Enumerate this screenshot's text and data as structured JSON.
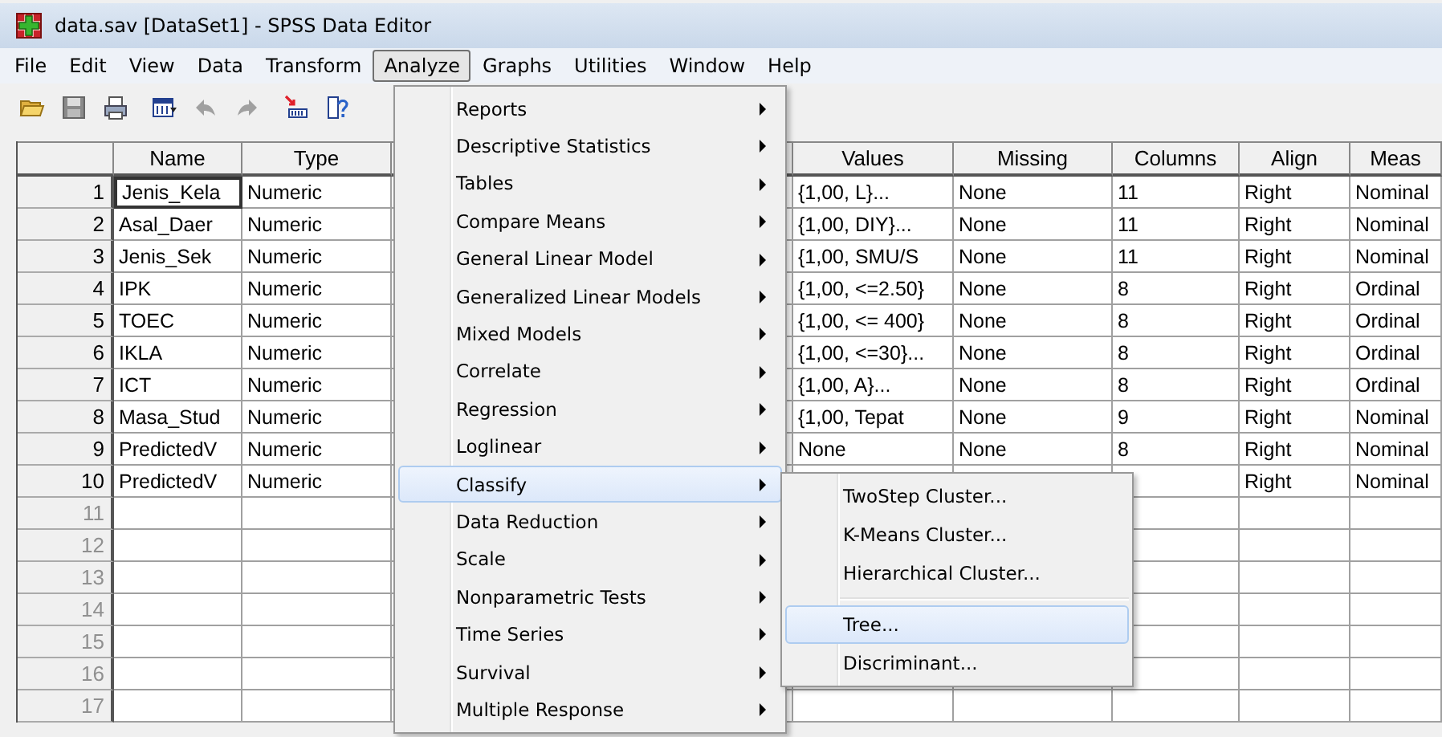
{
  "window": {
    "title": "data.sav [DataSet1] - SPSS Data Editor"
  },
  "menu_bar": [
    {
      "label": "File",
      "selected": false
    },
    {
      "label": "Edit",
      "selected": false
    },
    {
      "label": "View",
      "selected": false
    },
    {
      "label": "Data",
      "selected": false
    },
    {
      "label": "Transform",
      "selected": false
    },
    {
      "label": "Analyze",
      "selected": true
    },
    {
      "label": "Graphs",
      "selected": false
    },
    {
      "label": "Utilities",
      "selected": false
    },
    {
      "label": "Window",
      "selected": false
    },
    {
      "label": "Help",
      "selected": false
    }
  ],
  "grid": {
    "columns": [
      "Name",
      "Type",
      null,
      "Values",
      "Missing",
      "Columns",
      "Align",
      "Meas"
    ],
    "rows": [
      {
        "number": "1",
        "cursor": true,
        "cells": [
          "Jenis_Kela",
          "Numeric",
          null,
          "{1,00, L}...",
          "None",
          "11",
          "Right",
          "Nominal"
        ]
      },
      {
        "number": "2",
        "cursor": false,
        "cells": [
          "Asal_Daer",
          "Numeric",
          null,
          "{1,00, DIY}...",
          "None",
          "11",
          "Right",
          "Nominal"
        ]
      },
      {
        "number": "3",
        "cursor": false,
        "cells": [
          "Jenis_Sek",
          "Numeric",
          null,
          "{1,00, SMU/S",
          "None",
          "11",
          "Right",
          "Nominal"
        ]
      },
      {
        "number": "4",
        "cursor": false,
        "cells": [
          "IPK",
          "Numeric",
          null,
          "{1,00, <=2.50}",
          "None",
          "8",
          "Right",
          "Ordinal"
        ]
      },
      {
        "number": "5",
        "cursor": false,
        "cells": [
          "TOEC",
          "Numeric",
          null,
          "{1,00, <= 400}",
          "None",
          "8",
          "Right",
          "Ordinal"
        ]
      },
      {
        "number": "6",
        "cursor": false,
        "cells": [
          "IKLA",
          "Numeric",
          null,
          "{1,00, <=30}...",
          "None",
          "8",
          "Right",
          "Ordinal"
        ]
      },
      {
        "number": "7",
        "cursor": false,
        "cells": [
          "ICT",
          "Numeric",
          null,
          "{1,00, A}...",
          "None",
          "8",
          "Right",
          "Ordinal"
        ]
      },
      {
        "number": "8",
        "cursor": false,
        "cells": [
          "Masa_Stud",
          "Numeric",
          null,
          "{1,00, Tepat",
          "None",
          "9",
          "Right",
          "Nominal"
        ]
      },
      {
        "number": "9",
        "cursor": false,
        "cells": [
          "PredictedV",
          "Numeric",
          null,
          "None",
          "None",
          "8",
          "Right",
          "Nominal"
        ]
      },
      {
        "number": "10",
        "cursor": false,
        "cells": [
          "PredictedV",
          "Numeric",
          null,
          null,
          null,
          null,
          "Right",
          "Nominal"
        ]
      },
      {
        "number": "11"
      },
      {
        "number": "12"
      },
      {
        "number": "13"
      },
      {
        "number": "14"
      },
      {
        "number": "15"
      },
      {
        "number": "16"
      },
      {
        "number": "17"
      }
    ]
  },
  "analyze_menu": {
    "items": [
      {
        "label": "Reports",
        "has_submenu": true,
        "selected": false
      },
      {
        "label": "Descriptive Statistics",
        "has_submenu": true,
        "selected": false
      },
      {
        "label": "Tables",
        "has_submenu": true,
        "selected": false
      },
      {
        "label": "Compare Means",
        "has_submenu": true,
        "selected": false
      },
      {
        "label": "General Linear Model",
        "has_submenu": true,
        "selected": false
      },
      {
        "label": "Generalized Linear Models",
        "has_submenu": true,
        "selected": false
      },
      {
        "label": "Mixed Models",
        "has_submenu": true,
        "selected": false
      },
      {
        "label": "Correlate",
        "has_submenu": true,
        "selected": false
      },
      {
        "label": "Regression",
        "has_submenu": true,
        "selected": false
      },
      {
        "label": "Loglinear",
        "has_submenu": true,
        "selected": false
      },
      {
        "label": "Classify",
        "has_submenu": true,
        "selected": true
      },
      {
        "label": "Data Reduction",
        "has_submenu": true,
        "selected": false
      },
      {
        "label": "Scale",
        "has_submenu": true,
        "selected": false
      },
      {
        "label": "Nonparametric Tests",
        "has_submenu": true,
        "selected": false
      },
      {
        "label": "Time Series",
        "has_submenu": true,
        "selected": false
      },
      {
        "label": "Survival",
        "has_submenu": true,
        "selected": false
      },
      {
        "label": "Multiple Response",
        "has_submenu": true,
        "selected": false
      }
    ]
  },
  "classify_submenu": {
    "items": [
      {
        "kind": "item",
        "label": "TwoStep Cluster...",
        "selected": false
      },
      {
        "kind": "item",
        "label": "K-Means Cluster...",
        "selected": false
      },
      {
        "kind": "item",
        "label": "Hierarchical Cluster...",
        "selected": false
      },
      {
        "kind": "separator"
      },
      {
        "kind": "item",
        "label": "Tree...",
        "selected": true
      },
      {
        "kind": "item",
        "label": "Discriminant...",
        "selected": false
      }
    ]
  }
}
